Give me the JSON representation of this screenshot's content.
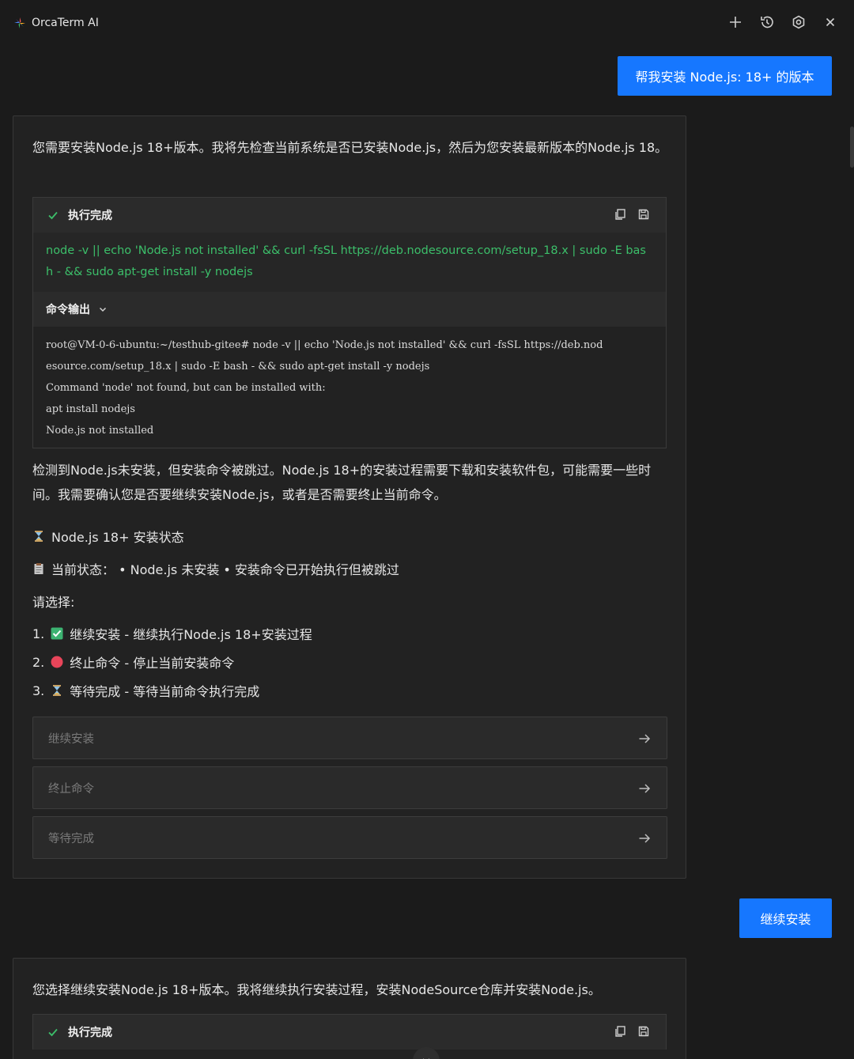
{
  "app": {
    "title": "OrcaTerm AI"
  },
  "toolbar": {
    "icons": [
      "plus-icon",
      "history-icon",
      "settings-icon",
      "close-icon"
    ]
  },
  "messages": {
    "user1": "帮我安装 Node.js: 18+ 的版本",
    "ai1": {
      "intro": "您需要安装Node.js 18+版本。我将先检查当前系统是否已安装Node.js，然后为您安装最新版本的Node.js 18。",
      "exec": {
        "status": "执行完成",
        "command": "node -v || echo 'Node.js not installed' && curl -fsSL https://deb.nodesource.com/setup_18.x | sudo -E bash - && sudo apt-get install -y nodejs",
        "output_label": "命令输出",
        "output_lines": [
          "root@VM-0-6-ubuntu:~/testhub-gitee# node -v || echo 'Node.js not installed' && curl -fsSL https://deb.nod",
          "esource.com/setup_18.x | sudo -E bash - && sudo apt-get install -y nodejs",
          "Command 'node' not found, but can be installed with:",
          "apt install nodejs",
          "Node.js not installed"
        ]
      },
      "detect": "检测到Node.js未安装，但安装命令被跳过。Node.js 18+的安装过程需要下载和安装软件包，可能需要一些时间。我需要确认您是否要继续安装Node.js，或者是否需要终止当前命令。",
      "status_title": "Node.js 18+ 安装状态",
      "current_status": "当前状态： • Node.js 未安装 • 安装命令已开始执行但被跳过",
      "choose": "请选择:",
      "choices": [
        {
          "num": "1.",
          "icon": "check-box-icon",
          "text": "继续安装 - 继续执行Node.js 18+安装过程"
        },
        {
          "num": "2.",
          "icon": "red-circle-icon",
          "text": "终止命令 - 停止当前安装命令"
        },
        {
          "num": "3.",
          "icon": "hourglass-icon",
          "text": "等待完成 - 等待当前命令执行完成"
        }
      ],
      "options": [
        "继续安装",
        "终止命令",
        "等待完成"
      ]
    },
    "user2": "继续安装",
    "ai2": {
      "intro": "您选择继续安装Node.js 18+版本。我将继续执行安装过程，安装NodeSource仓库并安装Node.js。",
      "exec_status": "执行完成"
    }
  },
  "colors": {
    "accent": "#1677ff",
    "command": "#3cbf6a",
    "success": "#3cbf6a"
  }
}
